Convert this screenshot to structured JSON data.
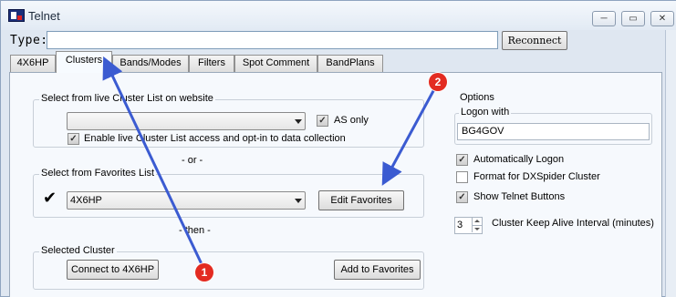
{
  "window": {
    "title": "Telnet",
    "minimize_symbol": "─",
    "restore_symbol": "▭",
    "close_symbol": "✕"
  },
  "type_row": {
    "label": "Type:",
    "input_value": "",
    "reconnect_label": "Reconnect"
  },
  "tabs": [
    {
      "label": "4X6HP"
    },
    {
      "label": "Clusters",
      "active": true
    },
    {
      "label": "Bands/Modes"
    },
    {
      "label": "Filters"
    },
    {
      "label": "Spot Comment"
    },
    {
      "label": "BandPlans"
    }
  ],
  "live_cluster": {
    "group_label": "Select from live Cluster List on website",
    "combo_value": "",
    "as_only_label": "AS only",
    "as_only_checked": true,
    "enable_label": "Enable live Cluster List access and opt-in to data collection",
    "enable_checked": true
  },
  "or_separator": "- or -",
  "favorites": {
    "group_label": "Select from Favorites List",
    "check_mark": "✔",
    "combo_value": "4X6HP",
    "edit_label": "Edit Favorites"
  },
  "then_separator": "- then -",
  "selected_cluster": {
    "group_label": "Selected Cluster",
    "connect_label": "Connect to 4X6HP",
    "add_label": "Add to Favorites"
  },
  "options": {
    "title": "Options",
    "logon_label": "Logon with",
    "logon_value": "BG4GOV",
    "auto_logon_label": "Automatically Logon",
    "auto_logon_checked": true,
    "dxspider_label": "Format for DXSpider Cluster",
    "dxspider_checked": false,
    "show_buttons_label": "Show Telnet Buttons",
    "show_buttons_checked": true,
    "keep_alive_value": "3",
    "keep_alive_label": "Cluster Keep Alive Interval (minutes)"
  },
  "annotations": [
    {
      "number": "1"
    },
    {
      "number": "2"
    }
  ],
  "colors": {
    "annotation_arrow": "#3b5bd1",
    "annotation_badge": "#e32b21"
  }
}
